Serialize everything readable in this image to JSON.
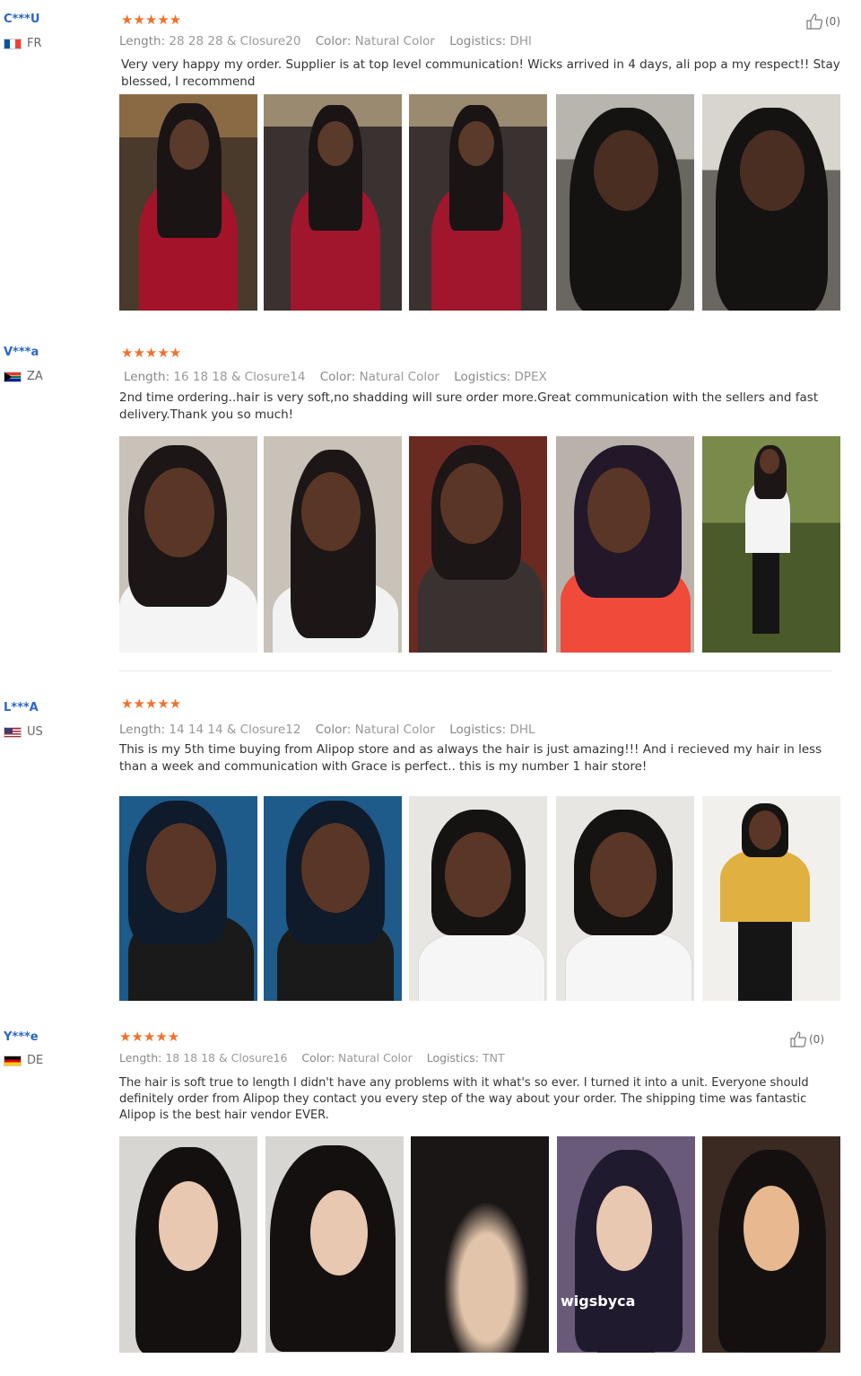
{
  "reviews": [
    {
      "user": "C***U",
      "country": "FR",
      "flag": "fr",
      "stars": "★★★★★",
      "length_label": "Length:",
      "length": "28 28 28 & Closure20",
      "color_label": "Color:",
      "color": "Natural Color",
      "logistics_label": "Logistics:",
      "logistics": "DHl",
      "comment": "Very very happy my order. Supplier is at top level communication! Wicks arrived in 4 days, ali pop a my respect!! Stay blessed, I recommend",
      "helpful": "(0)",
      "photos": [
        "red-dress-photo-1",
        "red-dress-photo-2",
        "red-dress-photo-3",
        "car-selfie-1",
        "car-selfie-2"
      ]
    },
    {
      "user": "V***a",
      "country": "ZA",
      "flag": "za",
      "stars": "★★★★★",
      "length_label": "Length:",
      "length": "16 18 18 & Closure14",
      "color_label": "Color:",
      "color": "Natural Color",
      "logistics_label": "Logistics:",
      "logistics": "DPEX",
      "comment": "2nd time ordering..hair is very soft,no shadding will sure order more.Great communication with the sellers and fast delivery.Thank you so much!",
      "helpful": "",
      "photos": [
        "car-selfie-white",
        "car-selfie-smile",
        "sequin-dress-selfie",
        "red-top-selfie",
        "garden-full-body"
      ]
    },
    {
      "user": "L***A",
      "country": "US",
      "flag": "us",
      "stars": "★★★★★",
      "length_label": "Length:",
      "length": "14 14 14 & Closure12",
      "color_label": "Color:",
      "color": "Natural Color",
      "logistics_label": "Logistics:",
      "logistics": "DHL",
      "comment": "This is my 5th time buying from Alipop store and as always the hair  is just amazing!!! And i recieved my hair in less than a week and communication with Grace is perfect.. this is my number 1 hair store!",
      "helpful": "",
      "photos": [
        "blue-selfie-1",
        "blue-selfie-2",
        "bob-selfie-1",
        "bob-selfie-2",
        "yellow-shirt-full"
      ]
    },
    {
      "user": "Y***e",
      "country": "DE",
      "flag": "de",
      "stars": "★★★★★",
      "length_label": "Length:",
      "length": "18 18 18 & Closure16",
      "color_label": "Color:",
      "color": "Natural Color",
      "logistics_label": "Logistics:",
      "logistics": "TNT",
      "comment": "The hair is soft true to length I didn't have any problems with it what's so ever. I turned it into a unit. Everyone should definitely order from Alipop they contact you every step of the way about your order. The shipping time was fantastic Alipop is the best hair vendor EVER.",
      "helpful": "(0)",
      "watermark": "wigsbyca",
      "photos": [
        "mannequin-wig-1",
        "mannequin-wig-2",
        "closure-part-closeup",
        "mannequin-wig-3",
        "mannequin-wig-4"
      ]
    }
  ],
  "colors": {
    "user_link": "#2a66c8",
    "stars": "#f0712d",
    "meta_text": "#999999",
    "divider": "#e6e6e6"
  }
}
